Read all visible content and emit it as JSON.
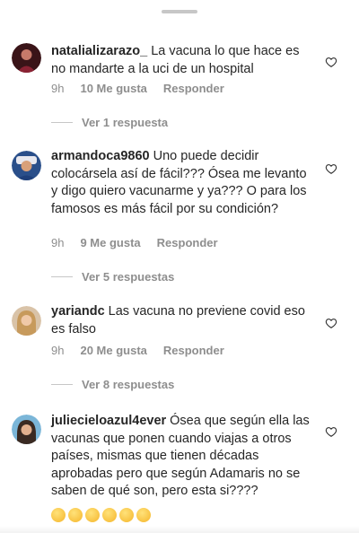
{
  "comments": [
    {
      "username": "natalializarazo_",
      "text": "La vacuna lo que hace es no mandarte a la uci de un hospital",
      "time": "9h",
      "likes": "10 Me gusta",
      "reply": "Responder",
      "view_replies": "Ver 1 respuesta"
    },
    {
      "username": "armandoca9860",
      "text": "Uno puede decidir colocársela así de fácil??? Ósea me levanto y digo quiero vacunarme y ya??? O para los famosos es más fácil por su condición?",
      "time": "9h",
      "likes": "9 Me gusta",
      "reply": "Responder",
      "view_replies": "Ver 5 respuestas"
    },
    {
      "username": "yariandc",
      "text": "Las vacuna no previene covid eso es falso",
      "time": "9h",
      "likes": "20 Me gusta",
      "reply": "Responder",
      "view_replies": "Ver 8 respuestas"
    },
    {
      "username": "juliecieloazul4ever",
      "text": "Ósea que según ella las vacunas que ponen cuando viajas a otros países, mismas que tienen décadas aprobadas pero que según Adamaris  no se saben de qué son, pero esta si????",
      "emojis": [
        "hushed-face",
        "face-with-raised-eyebrow",
        "face-with-rolling-eyes",
        "grimacing-face",
        "face-with-monocle",
        "smirking-face"
      ]
    }
  ],
  "icons": {
    "like": "heart-outline-icon",
    "grabber": "sheet-handle"
  },
  "colors": {
    "text": "#262626",
    "secondary": "#8e8e8e",
    "divider": "#c7c7c7"
  }
}
